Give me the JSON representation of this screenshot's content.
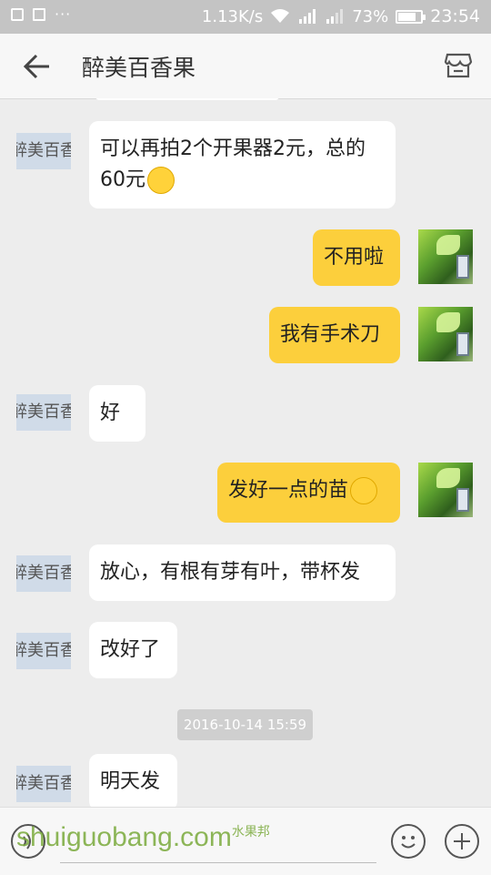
{
  "status_bar": {
    "network_speed": "1.13K/s",
    "battery_percent": "73%",
    "battery_level": 0.73,
    "time": "23:54",
    "icons": [
      "image-icon",
      "apps-icon",
      "more-dots-icon",
      "wifi-icon",
      "signal-4g-icon",
      "signal-2-icon",
      "battery-icon"
    ]
  },
  "header": {
    "title": "醉美百香果",
    "back_icon": "back-arrow-icon",
    "store_icon": "store-icon"
  },
  "contact": {
    "avatar_text": "醉美百香果"
  },
  "messages": [
    {
      "side": "in",
      "text": "可以再拍2个开果器2元，总的60元",
      "emoji": "thinking-face-emoji"
    },
    {
      "side": "out",
      "text": "不用啦"
    },
    {
      "side": "out",
      "text": "我有手术刀"
    },
    {
      "side": "in",
      "text": "好"
    },
    {
      "side": "out",
      "text": "发好一点的苗",
      "emoji": "pleading-face-emoji"
    },
    {
      "side": "in",
      "text": "放心，有根有芽有叶，带杯发"
    },
    {
      "side": "in",
      "text": "改好了"
    },
    {
      "side": "in",
      "text": "明天发"
    }
  ],
  "timestamp": "2016-10-14 15:59",
  "bottom_bar": {
    "input_value": "",
    "icons": [
      "voice-icon",
      "emoji-icon",
      "plus-icon"
    ]
  },
  "watermark": {
    "text": "shuiguobang.com",
    "chinese": "水果邦"
  },
  "colors": {
    "outgoing_bubble": "#fccf3c",
    "incoming_bubble": "#ffffff",
    "chat_background": "#ededed"
  }
}
